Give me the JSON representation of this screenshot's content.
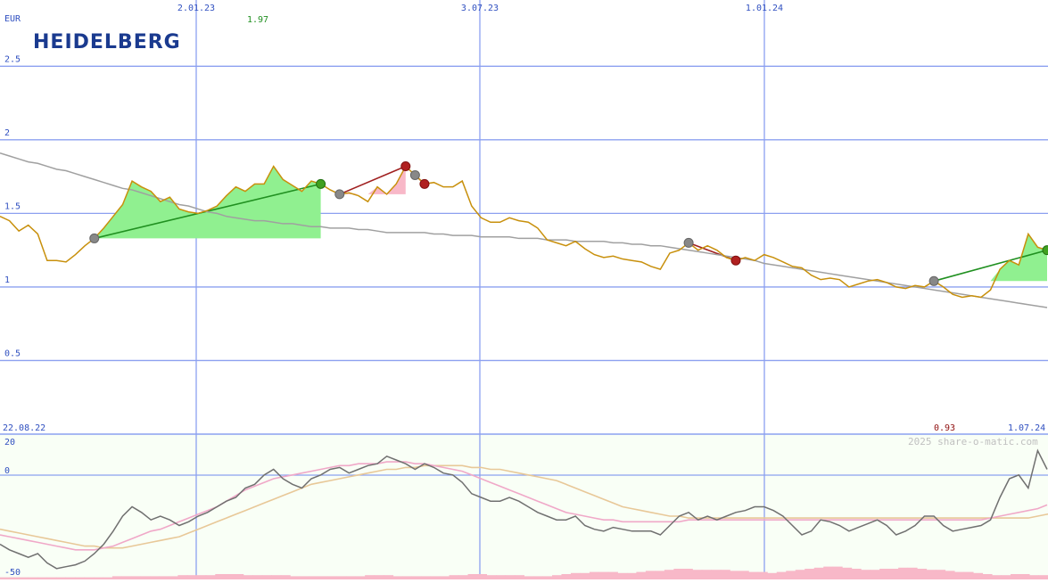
{
  "chart_data": {
    "type": "line",
    "title": "",
    "currency_label": "EUR",
    "logo_text": "HEIDELBERG",
    "max_price_label": "1.97",
    "min_price_label": "0.93",
    "watermark": "2025 share-o-matic.com",
    "date_start_label": "22.08.22",
    "date_end_label": "1.07.24",
    "x_tick_labels": [
      "2.01.23",
      "3.07.23",
      "1.01.24"
    ],
    "y_tick_labels": [
      "2.5",
      "2",
      "1.5",
      "1",
      "0.5"
    ],
    "y_ticks": [
      2.5,
      2.0,
      1.5,
      1.0,
      0.5
    ],
    "ylim": [
      0.0,
      2.95
    ],
    "grid": true,
    "colors": {
      "price": "#c8900c",
      "moving_average": "#a0a0a0",
      "grid": "#8ca0f0",
      "axis_labels": "#3050c0",
      "gain_fill": "#90f090",
      "loss_fill": "#f8b8c8",
      "gain_line": "#209020",
      "loss_line": "#a02020",
      "oscillator": "#707070",
      "osc_fast": "#f0a8c8",
      "osc_slow": "#e8c898",
      "volume": "#f8b8c8"
    },
    "series": [
      {
        "values": [
          1.48,
          1.45,
          1.38,
          1.42,
          1.36,
          1.18,
          1.18,
          1.17,
          1.22,
          1.28,
          1.33,
          1.4,
          1.48,
          1.56,
          1.72,
          1.68,
          1.65,
          1.58,
          1.61,
          1.53,
          1.51,
          1.5,
          1.52,
          1.55,
          1.62,
          1.68,
          1.65,
          1.7,
          1.7,
          1.82,
          1.73,
          1.69,
          1.65,
          1.72,
          1.7,
          1.66,
          1.63,
          1.64,
          1.62,
          1.58,
          1.68,
          1.63,
          1.7,
          1.82,
          1.76,
          1.7,
          1.71,
          1.68,
          1.68,
          1.72,
          1.55,
          1.47,
          1.44,
          1.44,
          1.47,
          1.45,
          1.44,
          1.4,
          1.32,
          1.3,
          1.28,
          1.31,
          1.26,
          1.22,
          1.2,
          1.21,
          1.19,
          1.18,
          1.17,
          1.14,
          1.12,
          1.23,
          1.25,
          1.3,
          1.25,
          1.28,
          1.25,
          1.2,
          1.18,
          1.2,
          1.18,
          1.22,
          1.2,
          1.17,
          1.14,
          1.13,
          1.08,
          1.05,
          1.06,
          1.05,
          1.0,
          1.02,
          1.04,
          1.05,
          1.03,
          1.0,
          0.99,
          1.01,
          1.0,
          1.04,
          1.0,
          0.95,
          0.93,
          0.94,
          0.93,
          0.98,
          1.12,
          1.18,
          1.15,
          1.36,
          1.27,
          1.25
        ]
      },
      {
        "values": [
          1.91,
          1.89,
          1.87,
          1.85,
          1.84,
          1.82,
          1.8,
          1.79,
          1.77,
          1.75,
          1.73,
          1.71,
          1.69,
          1.67,
          1.66,
          1.64,
          1.62,
          1.6,
          1.58,
          1.56,
          1.55,
          1.53,
          1.51,
          1.5,
          1.48,
          1.47,
          1.46,
          1.45,
          1.45,
          1.44,
          1.43,
          1.43,
          1.42,
          1.41,
          1.41,
          1.4,
          1.4,
          1.4,
          1.39,
          1.39,
          1.38,
          1.37,
          1.37,
          1.37,
          1.37,
          1.37,
          1.36,
          1.36,
          1.35,
          1.35,
          1.35,
          1.34,
          1.34,
          1.34,
          1.34,
          1.33,
          1.33,
          1.33,
          1.32,
          1.32,
          1.32,
          1.31,
          1.31,
          1.31,
          1.31,
          1.3,
          1.3,
          1.29,
          1.29,
          1.28,
          1.28,
          1.27,
          1.26,
          1.25,
          1.24,
          1.23,
          1.22,
          1.21,
          1.2,
          1.19,
          1.18,
          1.16,
          1.15,
          1.14,
          1.13,
          1.12,
          1.11,
          1.1,
          1.09,
          1.08,
          1.07,
          1.06,
          1.05,
          1.04,
          1.03,
          1.02,
          1.01,
          1.0,
          0.99,
          0.98,
          0.97,
          0.96,
          0.95,
          0.94,
          0.93,
          0.92,
          0.91,
          0.9,
          0.89,
          0.88,
          0.87,
          0.86
        ]
      }
    ],
    "signals": [
      {
        "from": 10,
        "to": 34,
        "kind": "gain"
      },
      {
        "from": 36,
        "to": 43,
        "kind": "loss"
      },
      {
        "from": 44,
        "to": 45,
        "kind": "loss"
      },
      {
        "from": 73,
        "to": 78,
        "kind": "loss"
      },
      {
        "from": 99,
        "to": 111,
        "kind": "gain"
      }
    ],
    "oscillator": {
      "ytick_labels": [
        "20",
        "0",
        "-50"
      ],
      "ylim": [
        -50,
        20
      ],
      "main": [
        -35,
        -38,
        -40,
        -42,
        -40,
        -45,
        -48,
        -47,
        -46,
        -44,
        -40,
        -35,
        -28,
        -20,
        -15,
        -18,
        -22,
        -20,
        -22,
        -25,
        -23,
        -20,
        -18,
        -15,
        -12,
        -10,
        -5,
        -3,
        2,
        5,
        0,
        -3,
        -5,
        0,
        2,
        5,
        6,
        3,
        5,
        7,
        8,
        12,
        10,
        8,
        5,
        8,
        6,
        3,
        2,
        -2,
        -8,
        -10,
        -12,
        -12,
        -10,
        -12,
        -15,
        -18,
        -20,
        -22,
        -22,
        -20,
        -25,
        -27,
        -28,
        -26,
        -27,
        -28,
        -28,
        -28,
        -30,
        -25,
        -20,
        -18,
        -22,
        -20,
        -22,
        -20,
        -18,
        -17,
        -15,
        -15,
        -17,
        -20,
        -25,
        -30,
        -28,
        -22,
        -23,
        -25,
        -28,
        -26,
        -24,
        -22,
        -25,
        -30,
        -28,
        -25,
        -20,
        -20,
        -25,
        -28,
        -27,
        -26,
        -25,
        -22,
        -10,
        0,
        2,
        -5,
        15,
        5
      ],
      "fast": [
        -30,
        -31,
        -32,
        -33,
        -34,
        -35,
        -36,
        -37,
        -38,
        -38,
        -38,
        -37,
        -36,
        -34,
        -32,
        -30,
        -28,
        -27,
        -25,
        -23,
        -21,
        -19,
        -17,
        -15,
        -12,
        -9,
        -6,
        -4,
        -2,
        0,
        1,
        2,
        3,
        4,
        5,
        6,
        7,
        7,
        8,
        8,
        8,
        9,
        9,
        9,
        8,
        8,
        7,
        6,
        5,
        4,
        2,
        0,
        -2,
        -4,
        -6,
        -8,
        -10,
        -12,
        -14,
        -16,
        -18,
        -19,
        -20,
        -21,
        -22,
        -22,
        -23,
        -23,
        -23,
        -23,
        -23,
        -23,
        -23,
        -22,
        -22,
        -22,
        -22,
        -22,
        -22,
        -22,
        -22,
        -22,
        -22,
        -22,
        -22,
        -22,
        -22,
        -22,
        -22,
        -22,
        -22,
        -22,
        -22,
        -22,
        -22,
        -22,
        -22,
        -22,
        -22,
        -22,
        -22,
        -22,
        -22,
        -22,
        -22,
        -21,
        -20,
        -19,
        -18,
        -17,
        -16,
        -14
      ],
      "slow": [
        -27,
        -28,
        -29,
        -30,
        -31,
        -32,
        -33,
        -34,
        -35,
        -36,
        -36,
        -37,
        -37,
        -37,
        -36,
        -35,
        -34,
        -33,
        -32,
        -31,
        -29,
        -27,
        -25,
        -23,
        -21,
        -19,
        -17,
        -15,
        -13,
        -11,
        -9,
        -7,
        -5,
        -3,
        -2,
        -1,
        0,
        1,
        2,
        3,
        4,
        5,
        5,
        6,
        6,
        7,
        7,
        7,
        7,
        7,
        6,
        6,
        5,
        5,
        4,
        3,
        2,
        1,
        0,
        -1,
        -3,
        -5,
        -7,
        -9,
        -11,
        -13,
        -15,
        -16,
        -17,
        -18,
        -19,
        -20,
        -20,
        -21,
        -21,
        -21,
        -21,
        -21,
        -21,
        -21,
        -21,
        -21,
        -21,
        -21,
        -21,
        -21,
        -21,
        -21,
        -21,
        -21,
        -21,
        -21,
        -21,
        -21,
        -21,
        -21,
        -21,
        -21,
        -21,
        -21,
        -21,
        -21,
        -21,
        -21,
        -21,
        -21,
        -21,
        -21,
        -21,
        -21,
        -20,
        -19,
        -18
      ]
    },
    "volume": [
      2,
      2,
      2,
      2,
      2,
      2,
      2,
      2,
      2,
      2,
      2,
      2,
      3,
      3,
      3,
      3,
      3,
      3,
      3,
      4,
      4,
      4,
      4,
      5,
      5,
      5,
      4,
      4,
      4,
      4,
      4,
      3,
      3,
      3,
      3,
      3,
      3,
      3,
      3,
      4,
      4,
      4,
      3,
      3,
      3,
      3,
      3,
      3,
      4,
      4,
      5,
      5,
      4,
      4,
      4,
      4,
      3,
      3,
      3,
      4,
      5,
      6,
      6,
      7,
      7,
      7,
      6,
      6,
      7,
      8,
      8,
      9,
      10,
      10,
      9,
      9,
      9,
      9,
      8,
      8,
      7,
      7,
      6,
      7,
      8,
      9,
      10,
      11,
      12,
      12,
      11,
      10,
      9,
      9,
      10,
      10,
      11,
      11,
      10,
      9,
      9,
      8,
      7,
      7,
      6,
      5,
      4,
      4,
      5,
      5,
      4,
      4
    ]
  }
}
